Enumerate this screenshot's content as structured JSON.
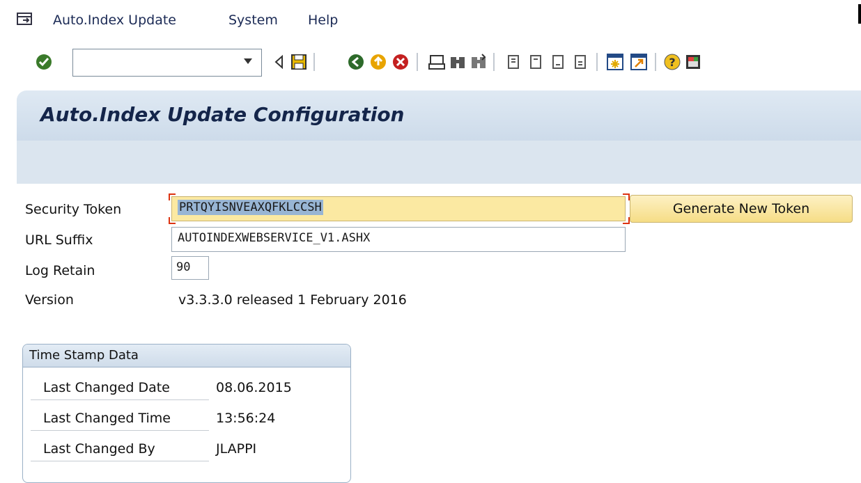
{
  "menubar": {
    "items": [
      {
        "label": "Auto.Index Update",
        "underline": "A",
        "rest": "uto.Index Update"
      },
      {
        "label": "System",
        "underline": "y",
        "pre": "S",
        "rest": "stem"
      },
      {
        "label": "Help",
        "underline": "H",
        "rest": "elp"
      }
    ]
  },
  "toolbar": {
    "command_field_value": "",
    "icons": [
      "enter-check-icon",
      "back-arrow-icon",
      "save-icon",
      "back-icon",
      "exit-icon",
      "cancel-icon",
      "print-icon",
      "find-icon",
      "find-next-icon",
      "first-page-icon",
      "previous-page-icon",
      "next-page-icon",
      "last-page-icon",
      "new-session-icon",
      "shortcut-icon",
      "help-icon",
      "customize-layout-icon"
    ]
  },
  "title": "Auto.Index Update Configuration",
  "form": {
    "security_token": {
      "label": "Security Token",
      "value": "PRTQYISNVEAXQFKLCCSH"
    },
    "generate_button": "Generate New Token",
    "url_suffix": {
      "label": "URL Suffix",
      "value": "AUTOINDEXWEBSERVICE_V1.ASHX"
    },
    "log_retain": {
      "label": "Log Retain",
      "value": "90"
    },
    "version": {
      "label": "Version",
      "value": "v3.3.3.0 released 1 February 2016"
    }
  },
  "timestamp": {
    "title": "Time Stamp Data",
    "rows": [
      {
        "label": "Last Changed Date",
        "value": "08.06.2015"
      },
      {
        "label": "Last Changed Time",
        "value": "13:56:24"
      },
      {
        "label": "Last Changed By",
        "value": "JLAPPI"
      }
    ]
  },
  "colors": {
    "title_band": "#cddbea",
    "token_field": "#fbe9a2",
    "button": "#f6dd86",
    "menu_text": "#1b2a55"
  }
}
